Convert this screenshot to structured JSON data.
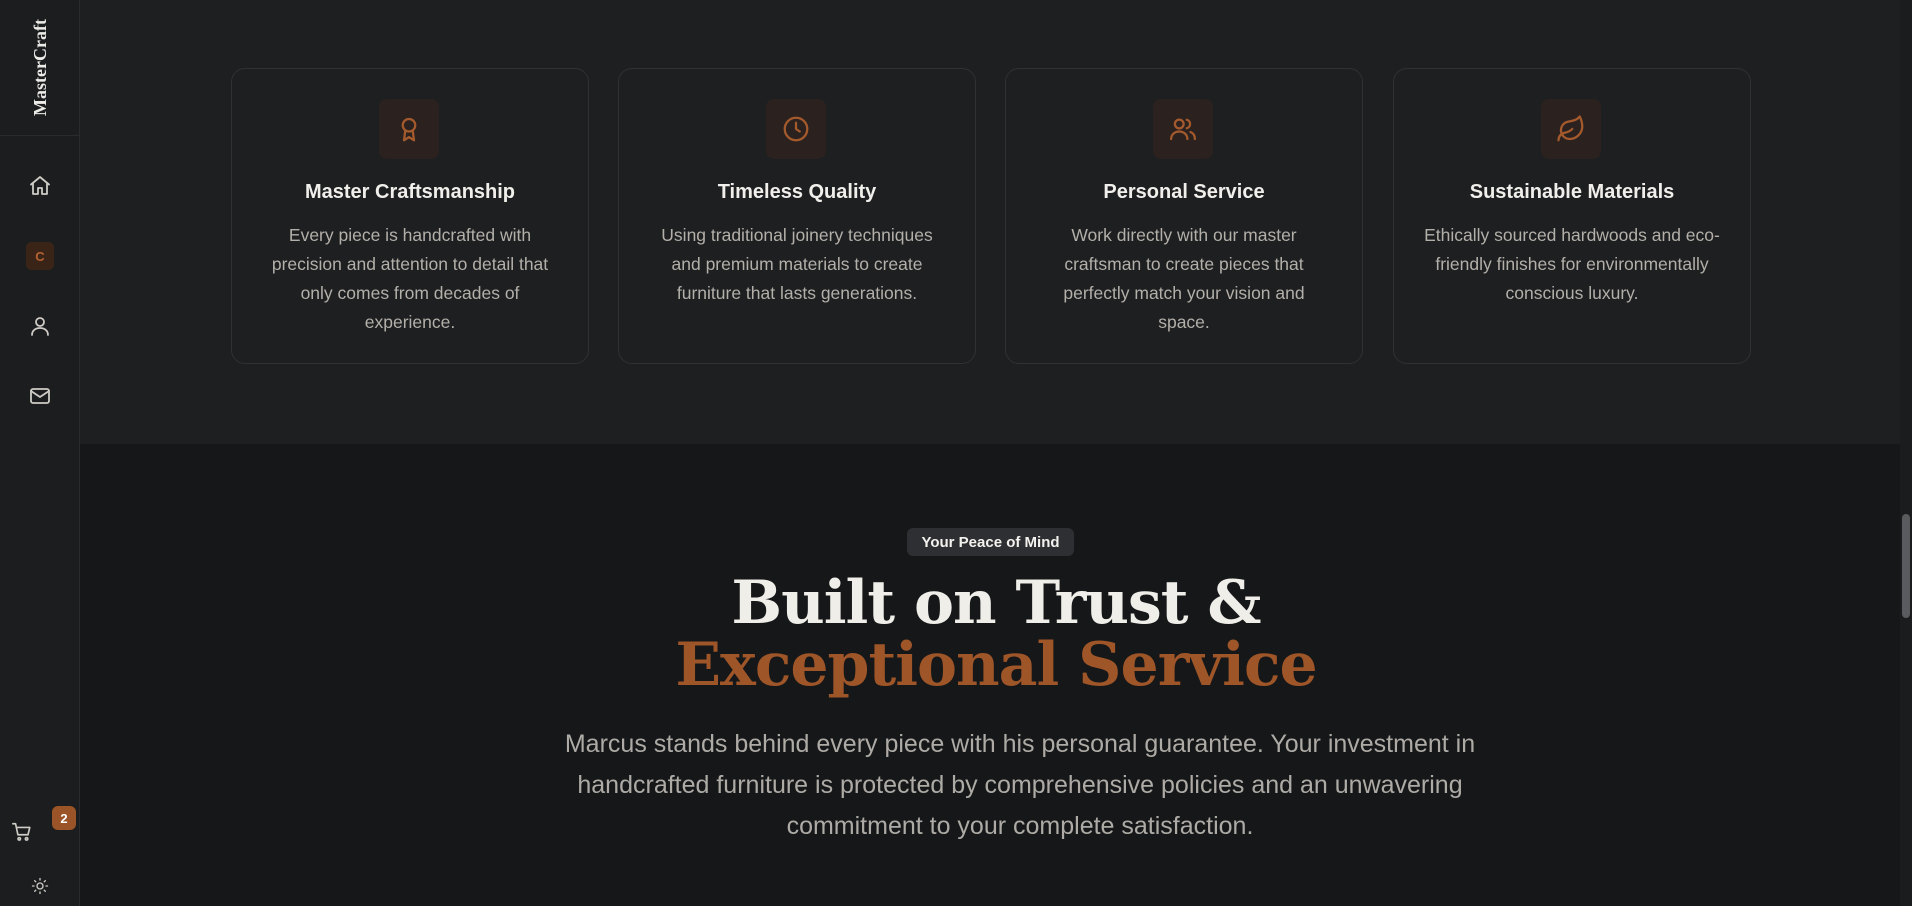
{
  "brand": {
    "name": "MasterCraft"
  },
  "sidebar": {
    "items": [
      {
        "icon": "home-icon"
      },
      {
        "icon": "craftsman-icon",
        "letter": "C"
      },
      {
        "icon": "user-icon"
      },
      {
        "icon": "mail-icon"
      }
    ],
    "cart": {
      "icon": "cart-icon",
      "count": "2"
    },
    "theme": {
      "icon": "sun-icon"
    }
  },
  "features": [
    {
      "icon": "award-icon",
      "title": "Master Craftsmanship",
      "description": "Every piece is handcrafted with precision and attention to detail that only comes from decades of experience."
    },
    {
      "icon": "clock-icon",
      "title": "Timeless Quality",
      "description": "Using traditional joinery techniques and premium materials to create furniture that lasts generations."
    },
    {
      "icon": "users-icon",
      "title": "Personal Service",
      "description": "Work directly with our master craftsman to create pieces that perfectly match your vision and space."
    },
    {
      "icon": "leaf-icon",
      "title": "Sustainable Materials",
      "description": "Ethically sourced hardwoods and eco-friendly finishes for environmentally conscious luxury."
    }
  ],
  "trust": {
    "badge": "Your Peace of Mind",
    "headline_line1": "Built on Trust &",
    "headline_line2": "Exceptional Service",
    "lead": "Marcus stands behind every piece with his personal guarantee. Your investment in handcrafted furniture is protected by comprehensive policies and an unwavering commitment to your complete satisfaction."
  },
  "colors": {
    "accent": "#9e5528",
    "background": "#161719",
    "surface": "#1e1f21"
  }
}
